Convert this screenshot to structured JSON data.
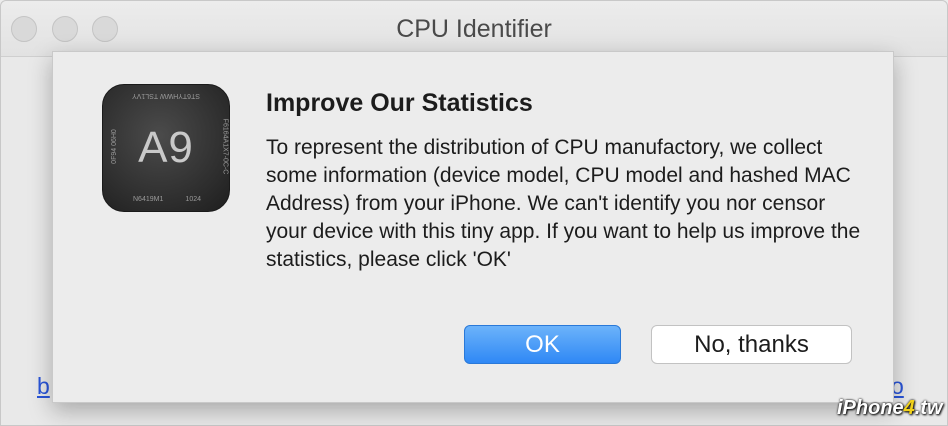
{
  "window": {
    "title": "CPU Identifier"
  },
  "background": {
    "link_left": "b",
    "link_right": "o"
  },
  "dialog": {
    "chip": {
      "main": "A9",
      "top": "ST6TYHWW TSL1VY",
      "bottom_left": "N6419M1",
      "bottom_right": "1024",
      "left": "0F94 06H0",
      "right": "F6164A1X7-0C-C"
    },
    "heading": "Improve Our Statistics",
    "message": "To represent the distribution of CPU manufactory, we collect some information (device model, CPU model and hashed MAC Address) from your iPhone. We can't identify you nor censor your device with this tiny app. If you want to help us improve the statistics, please click 'OK'",
    "buttons": {
      "ok": "OK",
      "no": "No, thanks"
    }
  },
  "watermark": {
    "prefix": "iPhone",
    "four": "4",
    "suffix": ".tw"
  }
}
